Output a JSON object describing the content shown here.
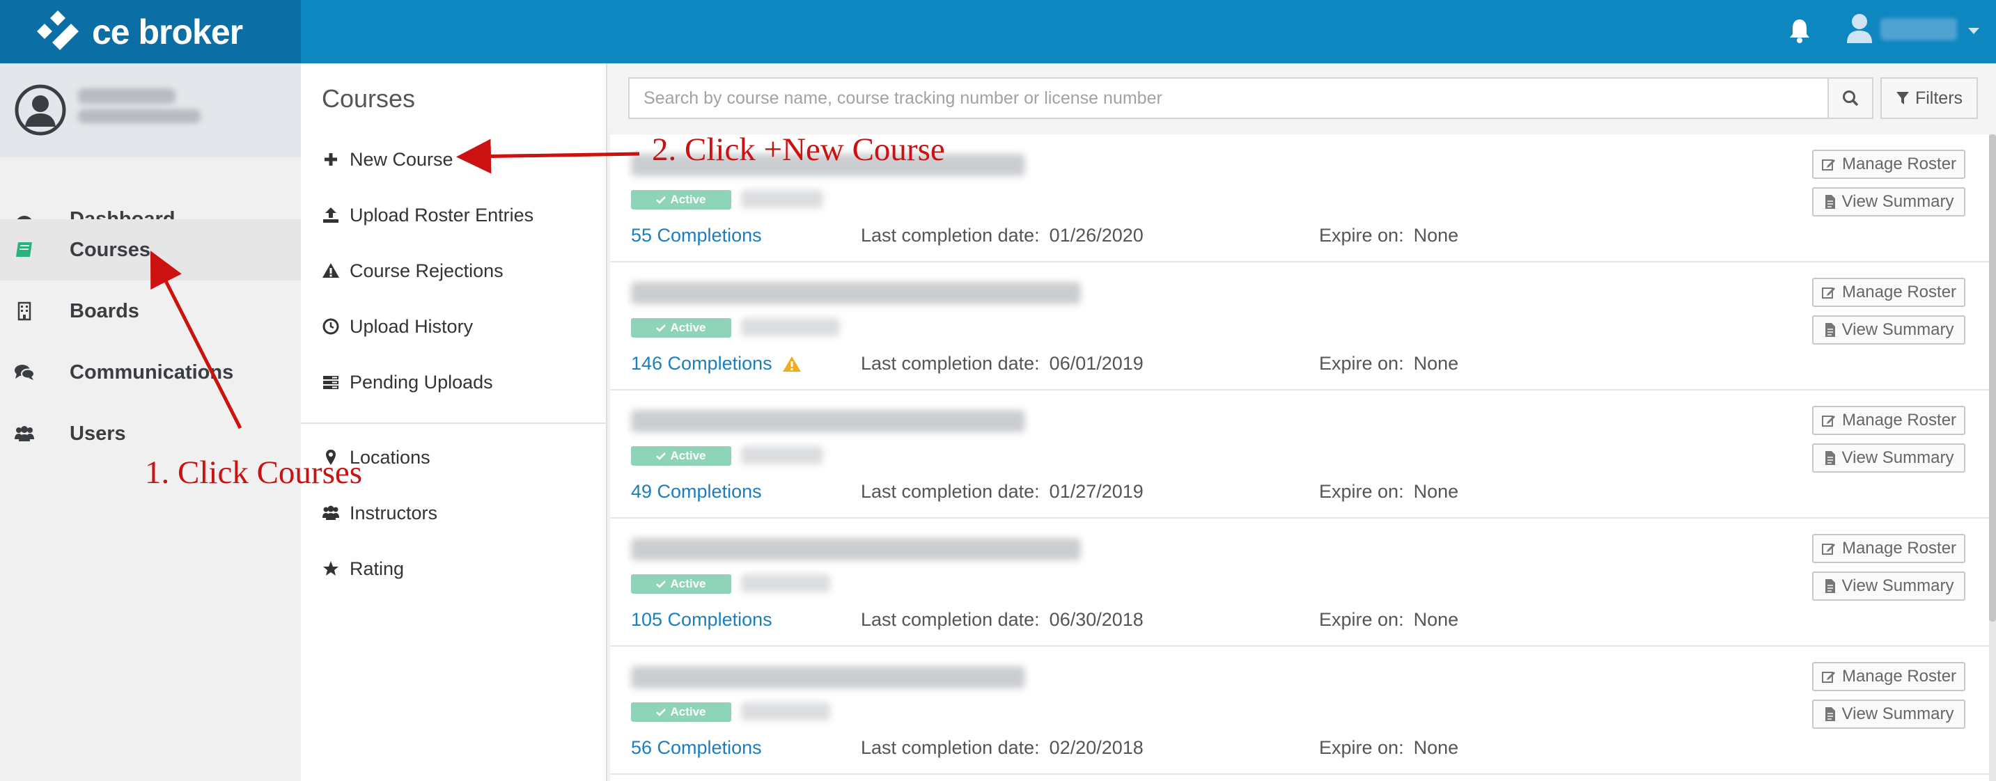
{
  "brand": {
    "logo_text": "ce broker",
    "topbar_color": "#0e86bf",
    "logo_bg": "#0b6ea5"
  },
  "sidebar": {
    "items": [
      {
        "label": "Dashboard",
        "icon": "dashboard-icon"
      },
      {
        "label": "Courses",
        "icon": "book-icon",
        "active": true
      },
      {
        "label": "Boards",
        "icon": "building-icon"
      },
      {
        "label": "Communications",
        "icon": "comments-icon"
      },
      {
        "label": "Users",
        "icon": "users-icon"
      }
    ]
  },
  "submenu": {
    "title": "Courses",
    "items": [
      {
        "label": "New Course",
        "icon": "plus-icon"
      },
      {
        "label": "Upload Roster Entries",
        "icon": "upload-icon"
      },
      {
        "label": "Course Rejections",
        "icon": "warning-icon"
      },
      {
        "label": "Upload History",
        "icon": "clock-icon"
      },
      {
        "label": "Pending Uploads",
        "icon": "tasks-icon"
      }
    ],
    "items2": [
      {
        "label": "Locations",
        "icon": "map-marker-icon"
      },
      {
        "label": "Instructors",
        "icon": "users-icon"
      },
      {
        "label": "Rating",
        "icon": "star-icon"
      }
    ]
  },
  "search": {
    "placeholder": "Search by course name, course tracking number or license number",
    "filters_label": "Filters"
  },
  "courses": [
    {
      "status": "Active",
      "completions": "55 Completions",
      "warning": false,
      "last_label": "Last completion date:",
      "last_date": "01/26/2020",
      "expire_label": "Expire on:",
      "expire": "None"
    },
    {
      "status": "Active",
      "completions": "146 Completions",
      "warning": true,
      "last_label": "Last completion date:",
      "last_date": "06/01/2019",
      "expire_label": "Expire on:",
      "expire": "None"
    },
    {
      "status": "Active",
      "completions": "49 Completions",
      "warning": false,
      "last_label": "Last completion date:",
      "last_date": "01/27/2019",
      "expire_label": "Expire on:",
      "expire": "None"
    },
    {
      "status": "Active",
      "completions": "105 Completions",
      "warning": false,
      "last_label": "Last completion date:",
      "last_date": "06/30/2018",
      "expire_label": "Expire on:",
      "expire": "None"
    },
    {
      "status": "Active",
      "completions": "56 Completions",
      "warning": false,
      "last_label": "Last completion date:",
      "last_date": "02/20/2018",
      "expire_label": "Expire on:",
      "expire": "None"
    }
  ],
  "row_buttons": {
    "manage": "Manage Roster",
    "summary": "View Summary"
  },
  "annotations": {
    "step1": "1. Click Courses",
    "step2": "2. Click +New Course",
    "color": "#cc1111"
  }
}
